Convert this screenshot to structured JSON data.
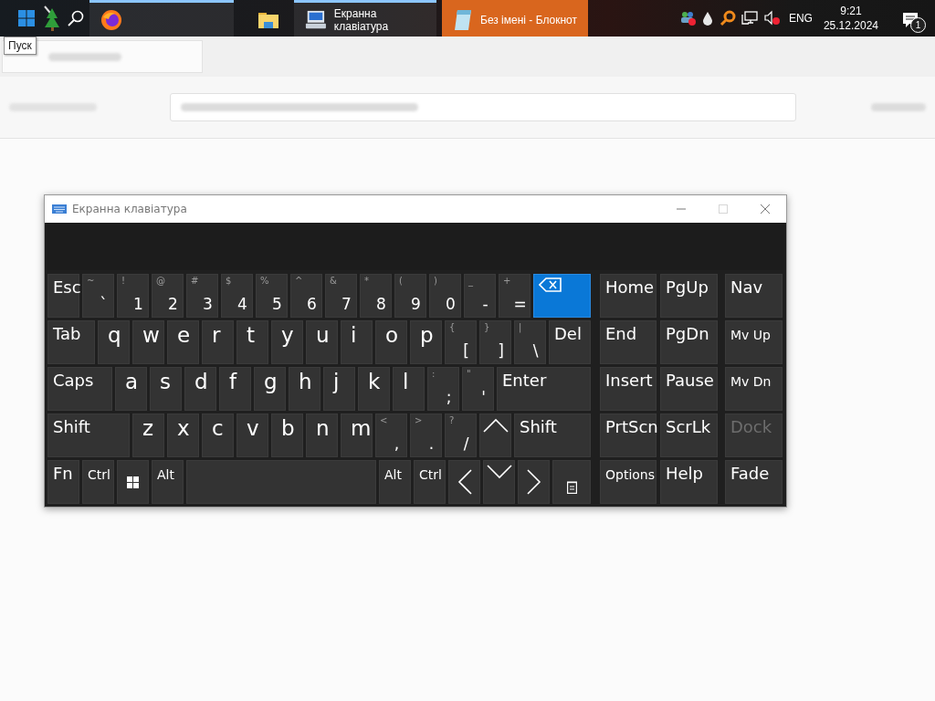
{
  "taskbar": {
    "start_tooltip": "Пуск",
    "apps": [
      {
        "kind": "firefox",
        "running": true,
        "flashing": false
      },
      {
        "kind": "explorer",
        "running": false,
        "flashing": false
      },
      {
        "kind": "keyboard",
        "label": "Екранна клавіатура",
        "running": true,
        "flashing": false
      },
      {
        "kind": "notepad",
        "label": "Без імені - Блокнот",
        "running": false,
        "flashing": true
      }
    ],
    "tray": {
      "language": "ENG",
      "time": "9:21",
      "date": "25.12.2024",
      "notifications": "1"
    }
  },
  "osk": {
    "title": "Екранна клавіатура",
    "controls": [
      {
        "kind": "minimize",
        "disabled": false
      },
      {
        "kind": "maximize",
        "disabled": true
      },
      {
        "kind": "close",
        "disabled": false
      }
    ],
    "main_rows": [
      {
        "keys": [
          {
            "kind": "label",
            "label": "Esc",
            "pressed": false
          },
          {
            "kind": "dual",
            "shift": "~",
            "label": "`",
            "pressed": false
          },
          {
            "kind": "dual",
            "shift": "!",
            "label": "1",
            "pressed": false
          },
          {
            "kind": "dual",
            "shift": "@",
            "label": "2",
            "pressed": false
          },
          {
            "kind": "dual",
            "shift": "#",
            "label": "3",
            "pressed": false
          },
          {
            "kind": "dual",
            "shift": "$",
            "label": "4",
            "pressed": false
          },
          {
            "kind": "dual",
            "shift": "%",
            "label": "5",
            "pressed": false
          },
          {
            "kind": "dual",
            "shift": "^",
            "label": "6",
            "pressed": false
          },
          {
            "kind": "dual",
            "shift": "&",
            "label": "7",
            "pressed": false
          },
          {
            "kind": "dual",
            "shift": "*",
            "label": "8",
            "pressed": false
          },
          {
            "kind": "dual",
            "shift": "(",
            "label": "9",
            "pressed": false
          },
          {
            "kind": "dual",
            "shift": ")",
            "label": "0",
            "pressed": false
          },
          {
            "kind": "dual",
            "shift": "_",
            "label": "-",
            "pressed": false
          },
          {
            "kind": "dual",
            "shift": "+",
            "label": "=",
            "pressed": false
          },
          {
            "kind": "backspace",
            "pressed": true
          }
        ]
      },
      {
        "keys": [
          {
            "kind": "label",
            "label": "Tab",
            "pressed": false
          },
          {
            "kind": "letter",
            "label": "q",
            "pressed": false
          },
          {
            "kind": "letter",
            "label": "w",
            "pressed": false
          },
          {
            "kind": "letter",
            "label": "e",
            "pressed": false
          },
          {
            "kind": "letter",
            "label": "r",
            "pressed": false
          },
          {
            "kind": "letter",
            "label": "t",
            "pressed": false
          },
          {
            "kind": "letter",
            "label": "y",
            "pressed": false
          },
          {
            "kind": "letter",
            "label": "u",
            "pressed": false
          },
          {
            "kind": "letter",
            "label": "i",
            "pressed": false
          },
          {
            "kind": "letter",
            "label": "o",
            "pressed": false
          },
          {
            "kind": "letter",
            "label": "p",
            "pressed": false
          },
          {
            "kind": "dual",
            "shift": "{",
            "label": "[",
            "pressed": false
          },
          {
            "kind": "dual",
            "shift": "}",
            "label": "]",
            "pressed": false
          },
          {
            "kind": "dual",
            "shift": "|",
            "label": "\\",
            "pressed": false
          },
          {
            "kind": "label",
            "label": "Del",
            "pressed": false
          }
        ]
      },
      {
        "keys": [
          {
            "kind": "label",
            "label": "Caps",
            "pressed": false
          },
          {
            "kind": "letter",
            "label": "a",
            "pressed": false
          },
          {
            "kind": "letter",
            "label": "s",
            "pressed": false
          },
          {
            "kind": "letter",
            "label": "d",
            "pressed": false
          },
          {
            "kind": "letter",
            "label": "f",
            "pressed": false
          },
          {
            "kind": "letter",
            "label": "g",
            "pressed": false
          },
          {
            "kind": "letter",
            "label": "h",
            "pressed": false
          },
          {
            "kind": "letter",
            "label": "j",
            "pressed": false
          },
          {
            "kind": "letter",
            "label": "k",
            "pressed": false
          },
          {
            "kind": "letter",
            "label": "l",
            "pressed": false
          },
          {
            "kind": "dual",
            "shift": ":",
            "label": ";",
            "pressed": false
          },
          {
            "kind": "dual",
            "shift": "\"",
            "label": "'",
            "pressed": false
          },
          {
            "kind": "label",
            "label": "Enter",
            "pressed": false
          }
        ]
      },
      {
        "keys": [
          {
            "kind": "label",
            "label": "Shift",
            "pressed": false
          },
          {
            "kind": "letter",
            "label": "z",
            "pressed": false
          },
          {
            "kind": "letter",
            "label": "x",
            "pressed": false
          },
          {
            "kind": "letter",
            "label": "c",
            "pressed": false
          },
          {
            "kind": "letter",
            "label": "v",
            "pressed": false
          },
          {
            "kind": "letter",
            "label": "b",
            "pressed": false
          },
          {
            "kind": "letter",
            "label": "n",
            "pressed": false
          },
          {
            "kind": "letter",
            "label": "m",
            "pressed": false
          },
          {
            "kind": "dual",
            "shift": "<",
            "label": ",",
            "pressed": false
          },
          {
            "kind": "dual",
            "shift": ">",
            "label": ".",
            "pressed": false
          },
          {
            "kind": "dual",
            "shift": "?",
            "label": "/",
            "pressed": false
          },
          {
            "kind": "arrow-up",
            "pressed": false
          },
          {
            "kind": "label",
            "label": "Shift",
            "pressed": false
          }
        ]
      },
      {
        "keys": [
          {
            "kind": "label",
            "label": "Fn",
            "pressed": false
          },
          {
            "kind": "small",
            "label": "Ctrl",
            "pressed": false
          },
          {
            "kind": "windows",
            "pressed": false
          },
          {
            "kind": "small",
            "label": "Alt",
            "pressed": false
          },
          {
            "kind": "space",
            "pressed": false
          },
          {
            "kind": "small",
            "label": "Alt",
            "pressed": false
          },
          {
            "kind": "small",
            "label": "Ctrl",
            "pressed": false
          },
          {
            "kind": "arrow-left",
            "pressed": false
          },
          {
            "kind": "arrow-down",
            "pressed": false
          },
          {
            "kind": "arrow-right",
            "pressed": false
          },
          {
            "kind": "menu",
            "pressed": false
          }
        ]
      }
    ],
    "nav_rows": [
      {
        "keys": [
          {
            "kind": "label",
            "label": "Home",
            "disabled": false
          },
          {
            "kind": "label",
            "label": "PgUp",
            "disabled": false
          },
          {
            "kind": "label",
            "label": "Nav",
            "disabled": false
          }
        ]
      },
      {
        "keys": [
          {
            "kind": "label",
            "label": "End",
            "disabled": false
          },
          {
            "kind": "label",
            "label": "PgDn",
            "disabled": false
          },
          {
            "kind": "small",
            "label": "Mv Up",
            "disabled": false
          }
        ]
      },
      {
        "keys": [
          {
            "kind": "label",
            "label": "Insert",
            "disabled": false
          },
          {
            "kind": "label",
            "label": "Pause",
            "disabled": false
          },
          {
            "kind": "small",
            "label": "Mv Dn",
            "disabled": false
          }
        ]
      },
      {
        "keys": [
          {
            "kind": "label",
            "label": "PrtScn",
            "disabled": false
          },
          {
            "kind": "label",
            "label": "ScrLk",
            "disabled": false
          },
          {
            "kind": "label",
            "label": "Dock",
            "disabled": true
          }
        ]
      },
      {
        "keys": [
          {
            "kind": "small",
            "label": "Options",
            "disabled": false
          },
          {
            "kind": "label",
            "label": "Help",
            "disabled": false
          },
          {
            "kind": "label",
            "label": "Fade",
            "disabled": false
          }
        ]
      }
    ]
  }
}
